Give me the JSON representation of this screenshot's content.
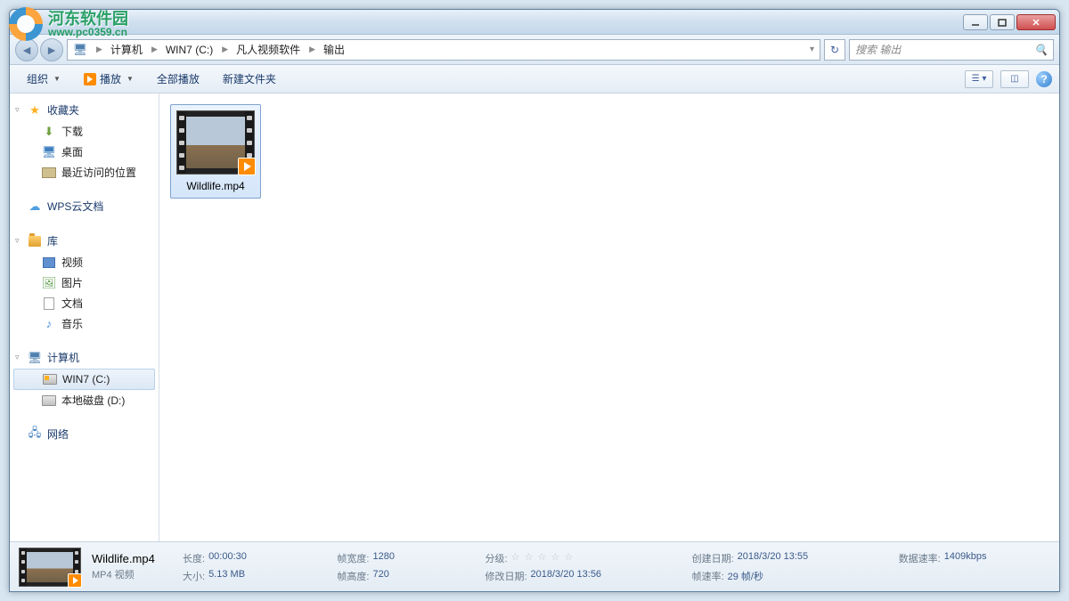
{
  "watermark": {
    "title": "河东软件园",
    "url": "www.pc0359.cn"
  },
  "breadcrumb": {
    "segs": [
      "计算机",
      "WIN7 (C:)",
      "凡人视频软件",
      "输出"
    ]
  },
  "search": {
    "placeholder": "搜索 输出"
  },
  "toolbar": {
    "organize": "组织",
    "play": "播放",
    "play_all": "全部播放",
    "new_folder": "新建文件夹"
  },
  "sidebar": {
    "favorites": {
      "label": "收藏夹",
      "items": [
        "下载",
        "桌面",
        "最近访问的位置"
      ]
    },
    "wps": "WPS云文档",
    "libraries": {
      "label": "库",
      "items": [
        "视频",
        "图片",
        "文档",
        "音乐"
      ]
    },
    "computer": {
      "label": "计算机",
      "items": [
        "WIN7 (C:)",
        "本地磁盘 (D:)"
      ]
    },
    "network": "网络"
  },
  "file": {
    "name": "Wildlife.mp4"
  },
  "details": {
    "name": "Wildlife.mp4",
    "type": "MP4 视频",
    "length_lbl": "长度:",
    "length": "00:00:30",
    "size_lbl": "大小:",
    "size": "5.13 MB",
    "fw_lbl": "帧宽度:",
    "fw": "1280",
    "fh_lbl": "帧高度:",
    "fh": "720",
    "rating_lbl": "分级:",
    "mod_lbl": "修改日期:",
    "mod": "2018/3/20 13:56",
    "created_lbl": "创建日期:",
    "created": "2018/3/20 13:55",
    "fps_lbl": "帧速率:",
    "fps": "29 帧/秒",
    "bitrate_lbl": "数据速率:",
    "bitrate": "1409kbps"
  }
}
